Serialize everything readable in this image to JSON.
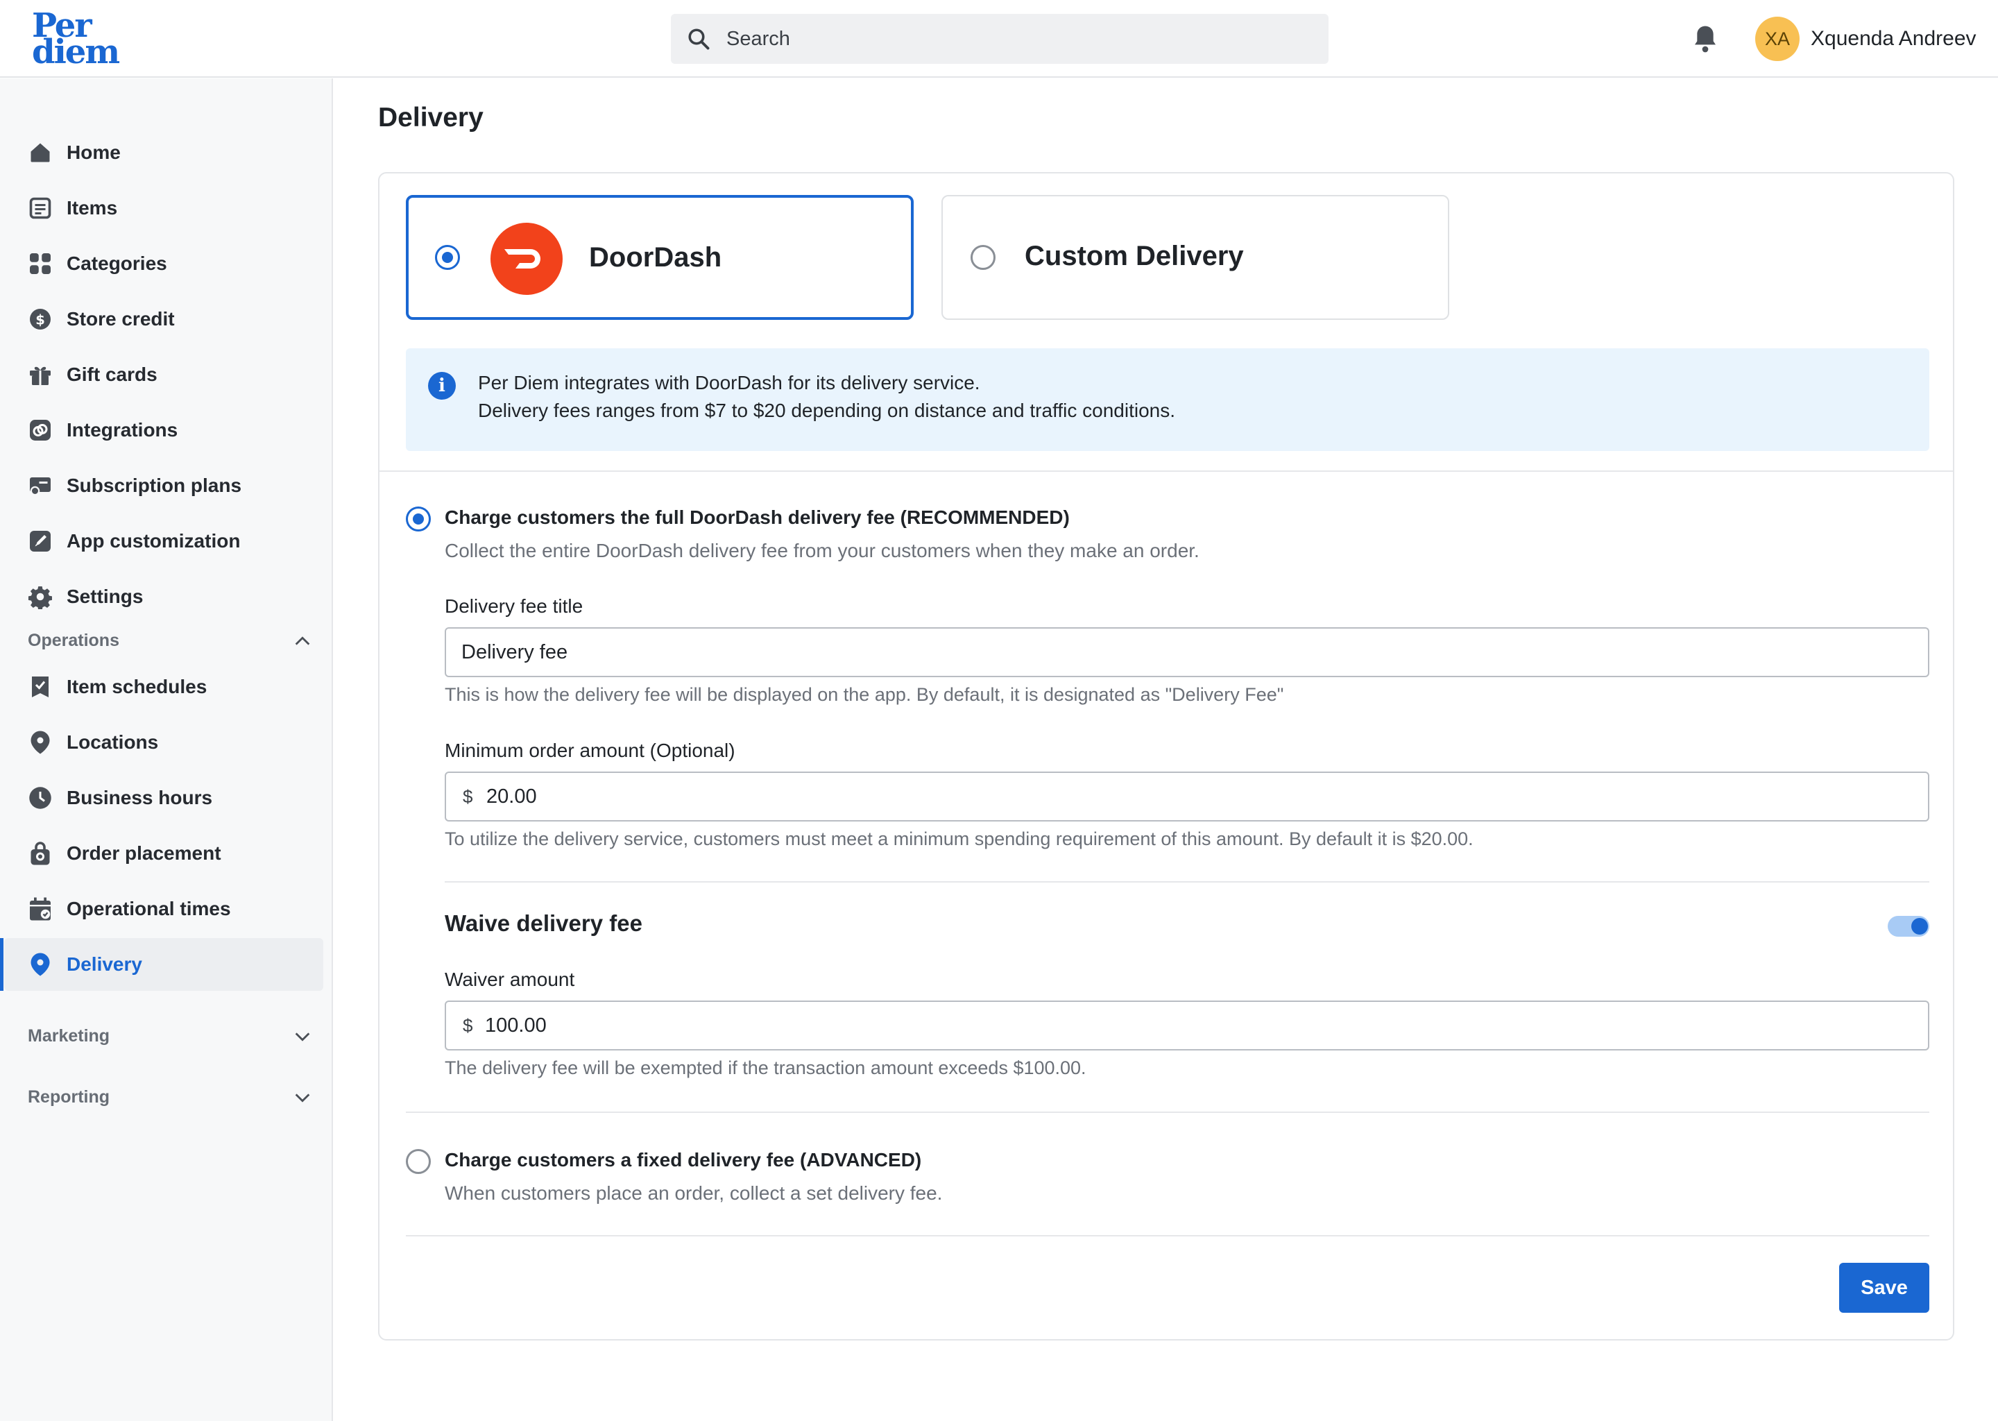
{
  "brand": {
    "logo_line1": "Per",
    "logo_line2": "diem",
    "accent": "#1a67d2"
  },
  "search": {
    "placeholder": "Search"
  },
  "user": {
    "initials": "XA",
    "name": "Xquenda Andreev"
  },
  "sidebar": {
    "main_items": [
      {
        "label": "Home",
        "icon": "home-icon"
      },
      {
        "label": "Items",
        "icon": "items-icon"
      },
      {
        "label": "Categories",
        "icon": "categories-icon"
      },
      {
        "label": "Store credit",
        "icon": "store-credit-icon"
      },
      {
        "label": "Gift cards",
        "icon": "gift-icon"
      },
      {
        "label": "Integrations",
        "icon": "integrations-icon"
      },
      {
        "label": "Subscription plans",
        "icon": "subscription-icon"
      },
      {
        "label": "App customization",
        "icon": "customization-icon"
      },
      {
        "label": "Settings",
        "icon": "gear-icon"
      }
    ],
    "operations_label": "Operations",
    "operations_items": [
      {
        "label": "Item schedules",
        "icon": "schedule-icon"
      },
      {
        "label": "Locations",
        "icon": "location-icon"
      },
      {
        "label": "Business hours",
        "icon": "clock-icon"
      },
      {
        "label": "Order placement",
        "icon": "bag-icon"
      },
      {
        "label": "Operational times",
        "icon": "calendar-icon"
      },
      {
        "label": "Delivery",
        "icon": "delivery-pin-icon",
        "active": true
      }
    ],
    "marketing_label": "Marketing",
    "reporting_label": "Reporting"
  },
  "page": {
    "title": "Delivery",
    "providers": {
      "doordash": "DoorDash",
      "custom": "Custom Delivery",
      "selected": "DoorDash"
    },
    "info": {
      "line1": "Per Diem integrates with DoorDash for its delivery service.",
      "line2": "Delivery fees ranges from $7 to $20 depending on distance and traffic conditions."
    },
    "full_fee": {
      "title": "Charge customers the full DoorDash delivery fee (RECOMMENDED)",
      "desc": "Collect the entire DoorDash delivery fee from your customers when they make an order.",
      "selected": true
    },
    "fee_title": {
      "label": "Delivery fee title",
      "value": "Delivery fee",
      "help": "This is how the delivery fee will be displayed on the app. By default, it is designated as \"Delivery Fee\""
    },
    "min_order": {
      "label": "Minimum order amount (Optional)",
      "prefix": "$",
      "value": "20.00",
      "help": "To utilize the delivery service, customers must meet a minimum spending requirement of this amount. By default it is $20.00."
    },
    "waive": {
      "title": "Waive delivery fee",
      "enabled": true,
      "label": "Waiver amount",
      "prefix": "$",
      "value": "100.00",
      "help": "The delivery fee will be exempted if the transaction amount exceeds $100.00."
    },
    "fixed_fee": {
      "title": "Charge customers a fixed delivery fee (ADVANCED)",
      "desc": "When customers place an order, collect a set delivery fee.",
      "selected": false
    },
    "save_label": "Save"
  }
}
